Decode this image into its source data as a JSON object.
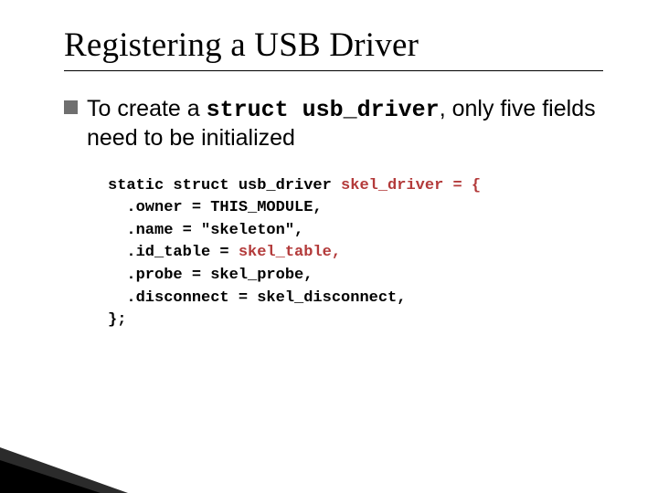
{
  "title": "Registering a USB Driver",
  "body": {
    "pre": "To create a ",
    "code": "struct usb_driver",
    "post": ", only five fields need to be initialized"
  },
  "code": {
    "l0a": "static struct usb_driver ",
    "l0b": "skel_driver = {",
    "l1": "  .owner = THIS_MODULE,",
    "l2": "  .name = \"skeleton\",",
    "l3a": "  .id_table = ",
    "l3b": "skel_table,",
    "l4": "  .probe = skel_probe,",
    "l5": "  .disconnect = skel_disconnect,",
    "l6": "};"
  }
}
